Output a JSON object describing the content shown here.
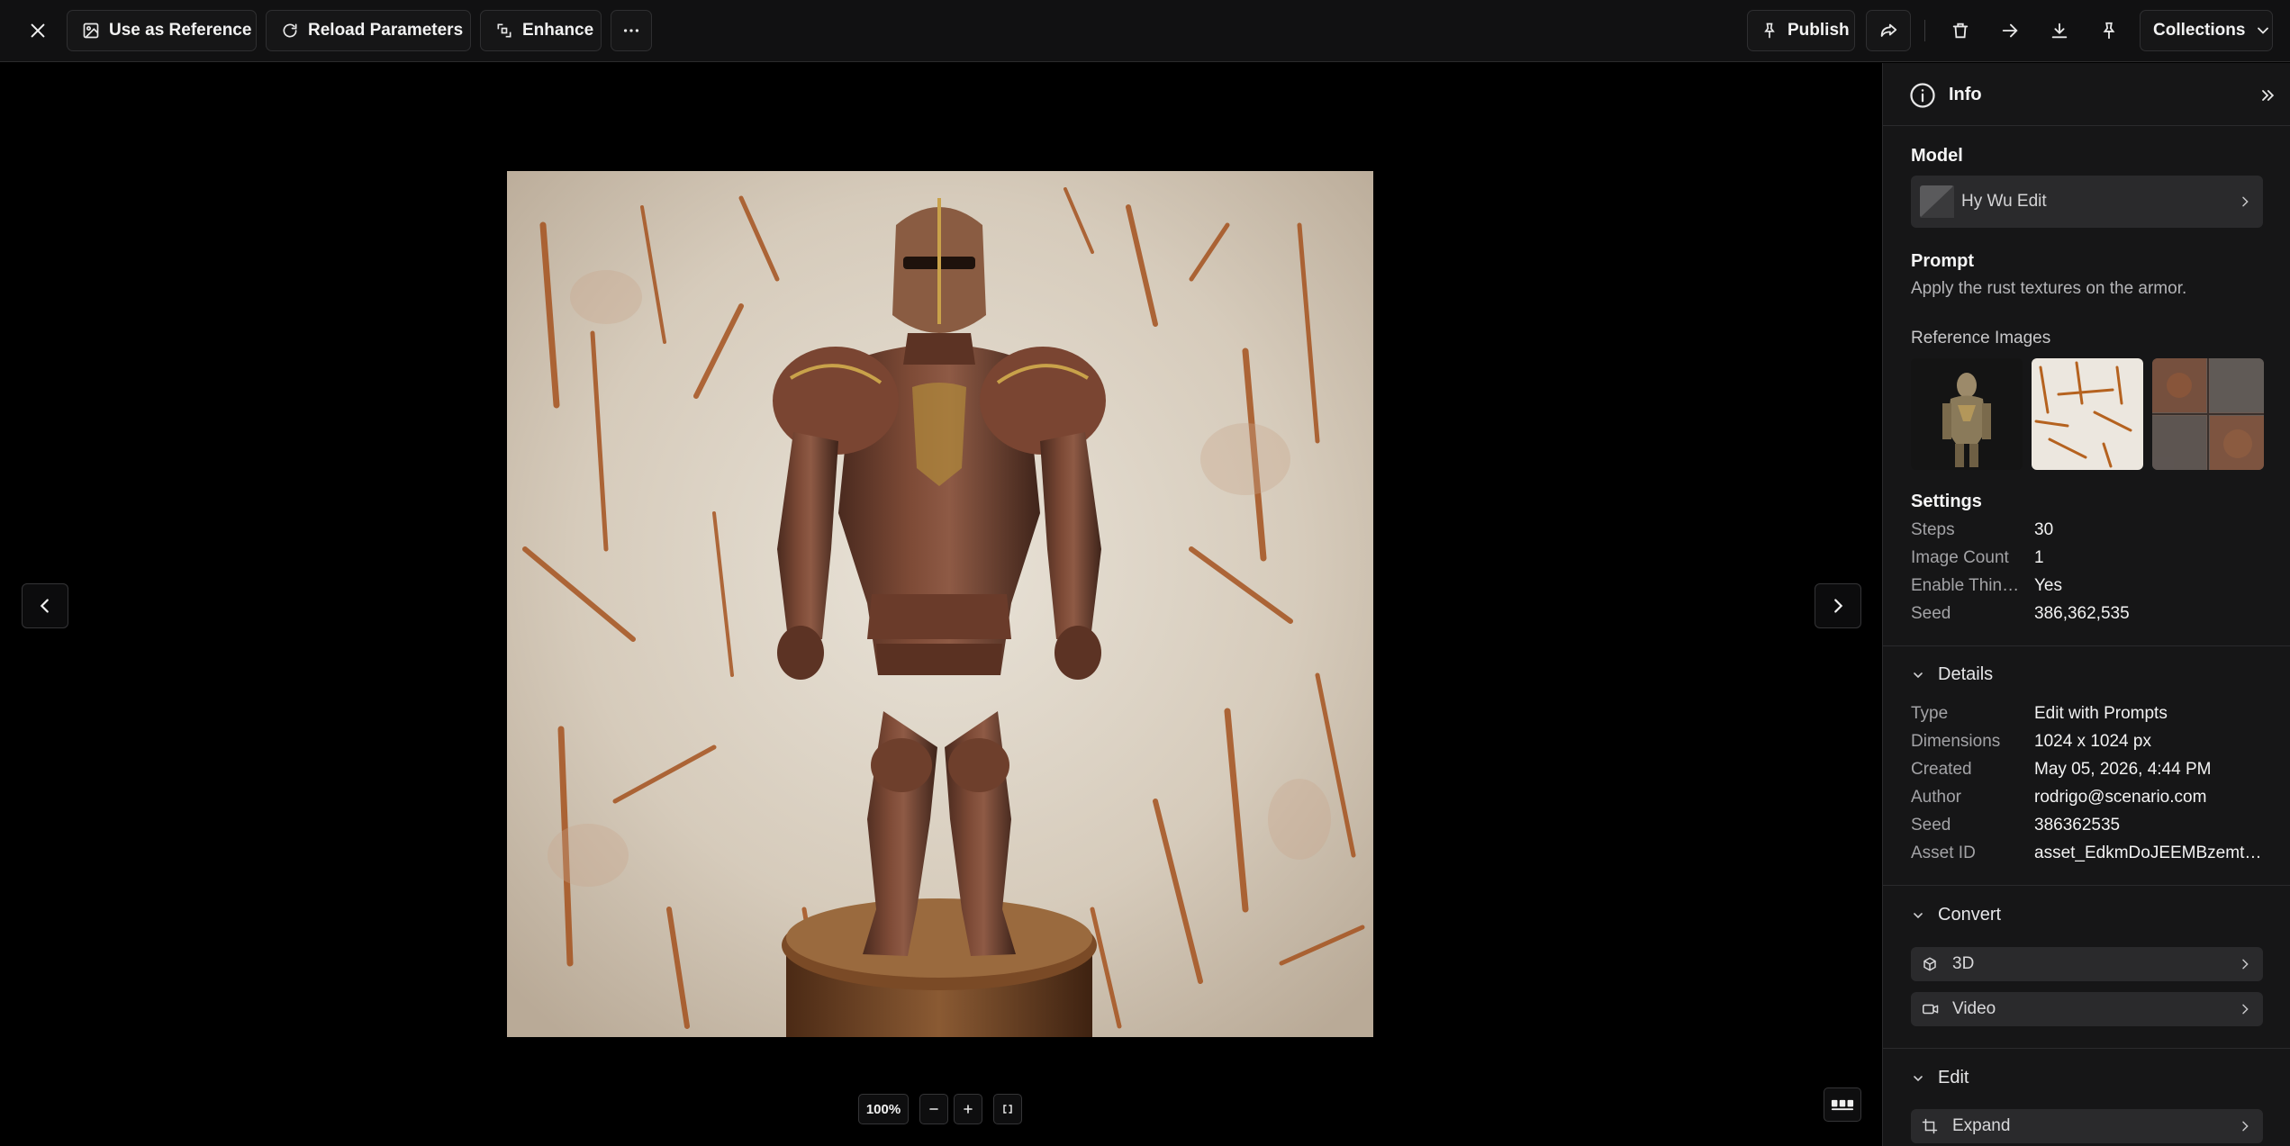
{
  "toolbar": {
    "close_icon": "close-icon",
    "use_as_reference": "Use as Reference",
    "reload_parameters": "Reload Parameters",
    "enhance": "Enhance",
    "more_icon": "more-horizontal-icon",
    "publish": "Publish",
    "collections": "Collections"
  },
  "viewer": {
    "zoom_level": "100%",
    "zoom_out_icon": "minus-icon",
    "zoom_in_icon": "plus-icon"
  },
  "panel": {
    "header_title": "Info",
    "model_title": "Model",
    "model_name": "Hy Wu Edit",
    "prompt_title": "Prompt",
    "prompt_text": "Apply the rust textures on the armor.",
    "reference_title": "Reference Images",
    "settings_title": "Settings",
    "settings": [
      {
        "key": "Steps",
        "value": "30"
      },
      {
        "key": "Image Count",
        "value": "1"
      },
      {
        "key": "Enable Thinking",
        "value": "Yes"
      },
      {
        "key": "Seed",
        "value": "386,362,535"
      }
    ],
    "details_title": "Details",
    "details": [
      {
        "key": "Type",
        "value": "Edit with Prompts"
      },
      {
        "key": "Dimensions",
        "value": "1024 x 1024 px"
      },
      {
        "key": "Created",
        "value": "May 05, 2026, 4:44 PM"
      },
      {
        "key": "Author",
        "value": "rodrigo@scenario.com"
      },
      {
        "key": "Seed",
        "value": "386362535"
      },
      {
        "key": "Asset ID",
        "value": "asset_EdkmDoJEEMBzemt7j..."
      }
    ],
    "convert_title": "Convert",
    "convert_items": [
      "3D",
      "Video"
    ],
    "edit_title": "Edit",
    "edit_items": [
      "Expand"
    ]
  },
  "colors": {
    "background": "#000000",
    "toolbar": "#111112",
    "panel": "#161617",
    "row_button": "#2a2a2c",
    "rust": "#a4521f"
  }
}
